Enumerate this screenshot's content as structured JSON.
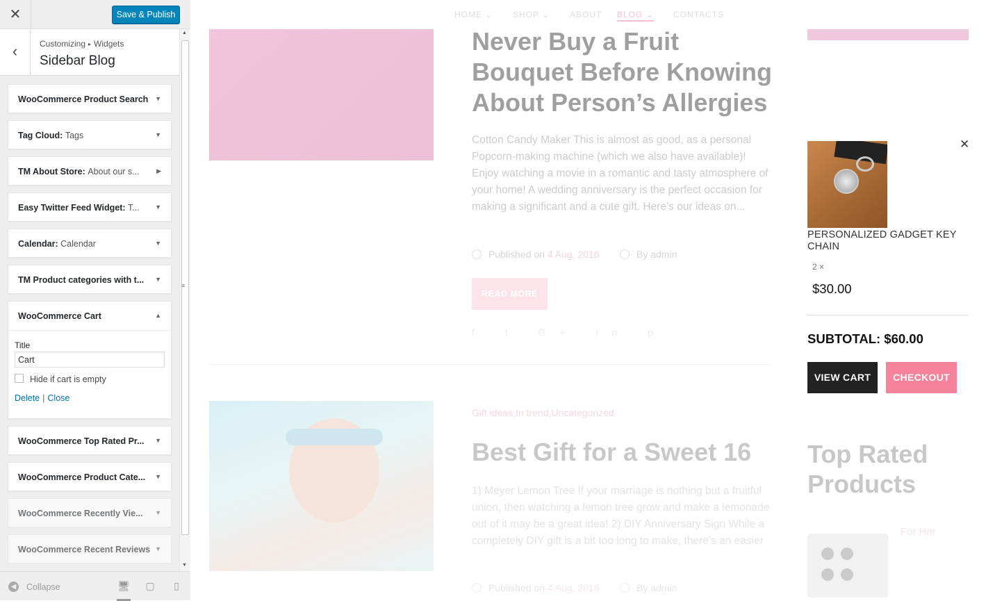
{
  "topbar": {
    "close_glyph": "✕",
    "save_label": "Save & Publish"
  },
  "header": {
    "back_glyph": "‹",
    "crumb_root": "Customizing",
    "crumb_sep": "▸",
    "crumb_current": "Widgets",
    "title": "Sidebar Blog"
  },
  "widgets": [
    {
      "title": "WooCommerce Product Search",
      "subtitle": "",
      "arrow": "▼"
    },
    {
      "title": "Tag Cloud:",
      "subtitle": "Tags",
      "arrow": "▼"
    },
    {
      "title": "TM About Store:",
      "subtitle": "About our s...",
      "arrow": "▶"
    },
    {
      "title": "Easy Twitter Feed Widget:",
      "subtitle": "T...",
      "arrow": "▼"
    },
    {
      "title": "Calendar:",
      "subtitle": "Calendar",
      "arrow": "▼"
    },
    {
      "title": "TM Product categories with t...",
      "subtitle": "",
      "arrow": "▼"
    },
    {
      "title": "WooCommerce Cart",
      "subtitle": "",
      "arrow": "▲"
    },
    {
      "title": "WooCommerce Top Rated Pr...",
      "subtitle": "",
      "arrow": "▼"
    },
    {
      "title": "WooCommerce Product Cate...",
      "subtitle": "",
      "arrow": "▼"
    },
    {
      "title": "WooCommerce Recently Vie...",
      "subtitle": "",
      "arrow": "▼"
    },
    {
      "title": "WooCommerce Recent Reviews",
      "subtitle": "",
      "arrow": "▼"
    }
  ],
  "cart_widget": {
    "title_label": "Title",
    "title_value": "Cart",
    "hide_label": "Hide if cart is empty",
    "delete_label": "Delete",
    "pipe": "|",
    "close_label": "Close"
  },
  "footer": {
    "collapse_label": "Collapse",
    "collapse_glyph": "◀",
    "desktop_glyph": "🖥",
    "tablet_glyph": "▢",
    "mobile_glyph": "▯"
  },
  "scroll": {
    "up": "▲",
    "down": "▼",
    "grip": "≡"
  },
  "nav": [
    "HOME ⌄",
    "SHOP ⌄",
    "ABOUT",
    "BLOG ⌄",
    "CONTACTS"
  ],
  "post1": {
    "title": "Never Buy a Fruit Bouquet Before Knowing About Person’s Allergies",
    "excerpt": "Cotton Candy Maker This is almost as good, as a personal Popcorn-making machine (which we also have available)! Enjoy watching a movie in a romantic and tasty atmosphere of your home! A wedding anniversary is the perfect occasion for making a significant and a cute gift. Here’s our ideas on...",
    "published_prefix": "Published on",
    "date": "4 Aug, 2016",
    "author": "By admin",
    "read_more": "READ MORE",
    "social": "f  t  G+  in  p"
  },
  "post2": {
    "categories": "Gift ideas,In trend,Uncategorized",
    "title": "Best Gift for a Sweet 16",
    "excerpt": "1) Meyer Lemon Tree If your marriage is nothing but a fruitful union, then watching a lemon tree grow and make a lemonade out of it may be a great idea! 2) DIY Anniversary Sign While a completely DIY gift is a bit too long to make, there’s an easier",
    "published_prefix": "Published on",
    "date": "4 Aug, 2016",
    "author": "By admin"
  },
  "cart": {
    "close_glyph": "✕",
    "product_name": "PERSONALIZED GADGET KEY CHAIN",
    "qty": "2 ×",
    "price": "$30.00",
    "subtotal": "SUBTOTAL: $60.00",
    "view_cart": "VIEW CART",
    "checkout": "CHECKOUT"
  },
  "top_rated": {
    "title": "Top Rated Products",
    "tag": "For Her"
  },
  "colors": {
    "accent_blue": "#0085ba",
    "checkout_pink": "#f7829a",
    "view_cart_dark": "#222222"
  }
}
